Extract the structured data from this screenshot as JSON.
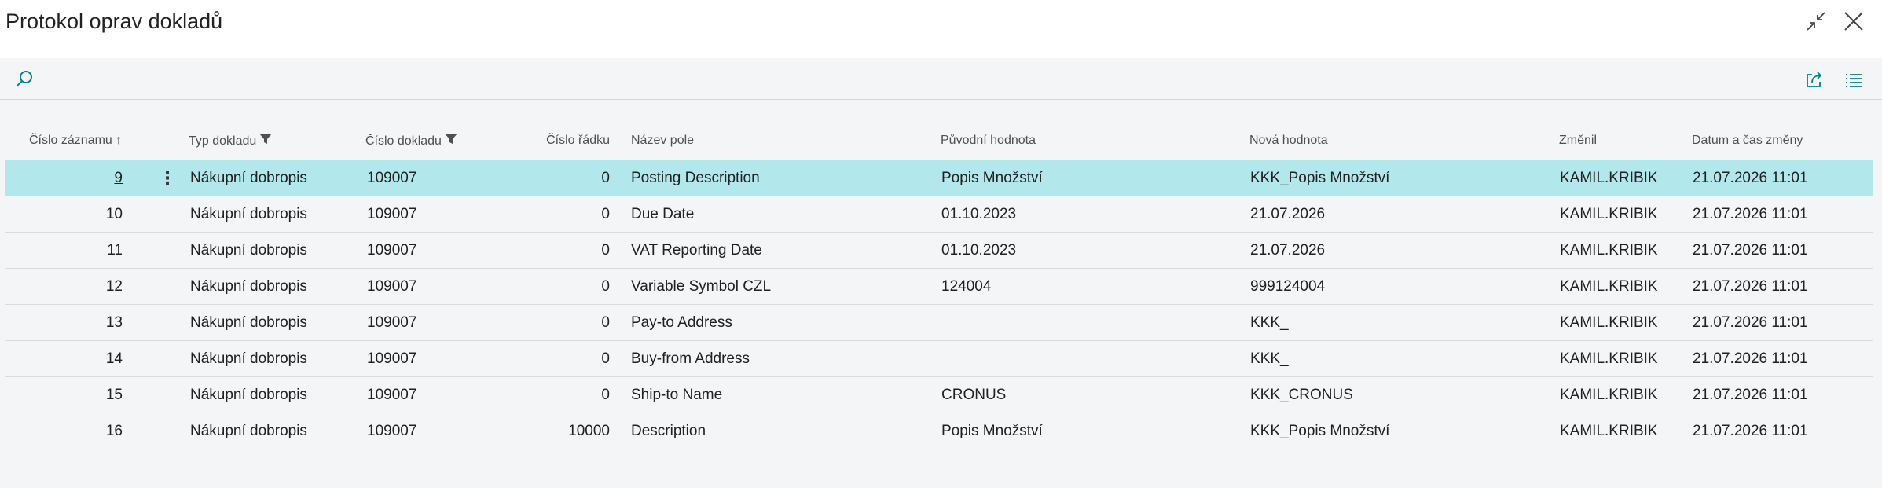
{
  "page": {
    "title": "Protokol oprav dokladů"
  },
  "header_icons": [
    "collapse-icon",
    "close-icon"
  ],
  "toolbar_icons": [
    "search-icon",
    "share-icon",
    "list-view-icon"
  ],
  "columns": [
    {
      "label": "Číslo záznamu",
      "indicator": "↑"
    },
    {
      "label": "Typ dokladu"
    },
    {
      "label": "Číslo dokladu"
    },
    {
      "label": "Číslo řádku"
    },
    {
      "label": "Název pole"
    },
    {
      "label": "Původní hodnota"
    },
    {
      "label": "Nová hodnota"
    },
    {
      "label": "Změnil"
    },
    {
      "label": "Datum a čas změny"
    }
  ],
  "filter_icon": "filter-icon",
  "row_menu_glyph": "⋮",
  "rows": [
    {
      "no": "9",
      "doc_type": "Nákupní dobropis",
      "doc_no": "109007",
      "line_no": "0",
      "field": "Posting Description",
      "old": "Popis Množství",
      "new": "KKK_Popis Množství",
      "user": "KAMIL.KRIBIK",
      "datetime": "21.07.2026 11:01"
    },
    {
      "no": "10",
      "doc_type": "Nákupní dobropis",
      "doc_no": "109007",
      "line_no": "0",
      "field": "Due Date",
      "old": "01.10.2023",
      "new": "21.07.2026",
      "user": "KAMIL.KRIBIK",
      "datetime": "21.07.2026 11:01"
    },
    {
      "no": "11",
      "doc_type": "Nákupní dobropis",
      "doc_no": "109007",
      "line_no": "0",
      "field": "VAT Reporting Date",
      "old": "01.10.2023",
      "new": "21.07.2026",
      "user": "KAMIL.KRIBIK",
      "datetime": "21.07.2026 11:01"
    },
    {
      "no": "12",
      "doc_type": "Nákupní dobropis",
      "doc_no": "109007",
      "line_no": "0",
      "field": "Variable Symbol CZL",
      "old": "124004",
      "new": "999124004",
      "user": "KAMIL.KRIBIK",
      "datetime": "21.07.2026 11:01"
    },
    {
      "no": "13",
      "doc_type": "Nákupní dobropis",
      "doc_no": "109007",
      "line_no": "0",
      "field": "Pay-to Address",
      "old": "",
      "new": "KKK_",
      "user": "KAMIL.KRIBIK",
      "datetime": "21.07.2026 11:01"
    },
    {
      "no": "14",
      "doc_type": "Nákupní dobropis",
      "doc_no": "109007",
      "line_no": "0",
      "field": "Buy-from Address",
      "old": "",
      "new": "KKK_",
      "user": "KAMIL.KRIBIK",
      "datetime": "21.07.2026 11:01"
    },
    {
      "no": "15",
      "doc_type": "Nákupní dobropis",
      "doc_no": "109007",
      "line_no": "0",
      "field": "Ship-to Name",
      "old": "CRONUS",
      "new": "KKK_CRONUS",
      "user": "KAMIL.KRIBIK",
      "datetime": "21.07.2026 11:01"
    },
    {
      "no": "16",
      "doc_type": "Nákupní dobropis",
      "doc_no": "109007",
      "line_no": "10000",
      "field": "Description",
      "old": "Popis Množství",
      "new": "KKK_Popis Množství",
      "user": "KAMIL.KRIBIK",
      "datetime": "21.07.2026 11:01"
    }
  ],
  "selected_row": 0,
  "colors": {
    "accent": "#008489",
    "selected_row": "#b2e8ec",
    "background": "#f4f5f7"
  }
}
